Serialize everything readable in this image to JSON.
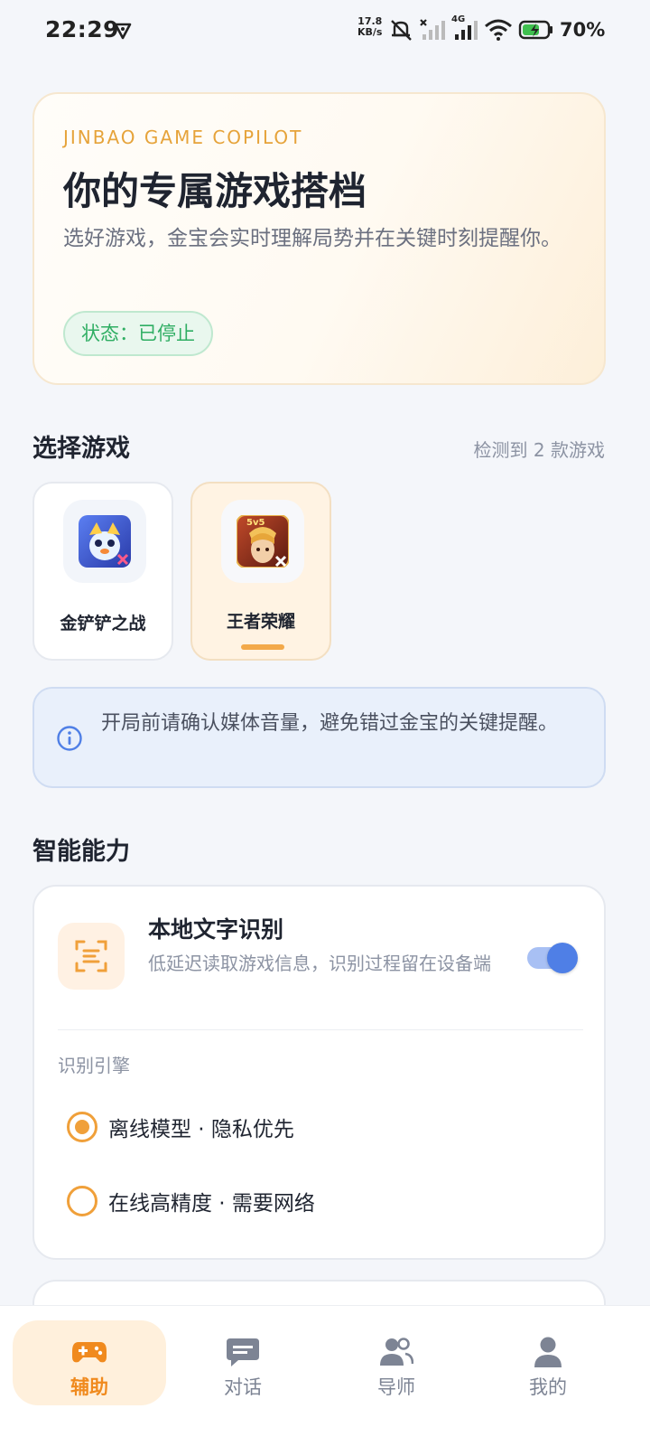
{
  "status_bar": {
    "time": "22:29",
    "net_speed_value": "17.8",
    "net_speed_unit": "KB/s",
    "signal_label": "4G",
    "battery": "70%"
  },
  "hero": {
    "eyebrow": "JINBAO GAME COPILOT",
    "title": "你的专属游戏搭档",
    "description": "选好游戏，金宝会实时理解局势并在关键时刻提醒你。",
    "status": "状态：已停止"
  },
  "games_section": {
    "title": "选择游戏",
    "meta": "检测到 2 款游戏",
    "games": [
      {
        "label": "金铲铲之战",
        "selected": false
      },
      {
        "label": "王者荣耀",
        "selected": true,
        "icon_badge": "5v5"
      }
    ]
  },
  "notice": {
    "text": "开局前请确认媒体音量，避免错过金宝的关键提醒。"
  },
  "capabilities": {
    "title": "智能能力",
    "ocr": {
      "title": "本地文字识别",
      "description": "低延迟读取游戏信息，识别过程留在设备端",
      "enabled": true
    },
    "engine_label": "识别引擎",
    "engines": [
      {
        "label": "离线模型 · 隐私优先",
        "checked": true
      },
      {
        "label": "在线高精度 · 需要网络",
        "checked": false
      }
    ]
  },
  "bottom_nav": {
    "items": [
      {
        "label": "辅助",
        "icon": "gamepad-icon",
        "active": true
      },
      {
        "label": "对话",
        "icon": "chat-icon",
        "active": false
      },
      {
        "label": "导师",
        "icon": "mentor-icon",
        "active": false
      },
      {
        "label": "我的",
        "icon": "profile-icon",
        "active": false
      }
    ]
  },
  "colors": {
    "accent_orange": "#f08a1e",
    "status_green": "#2fae63",
    "toggle_blue": "#4f7fe6"
  }
}
